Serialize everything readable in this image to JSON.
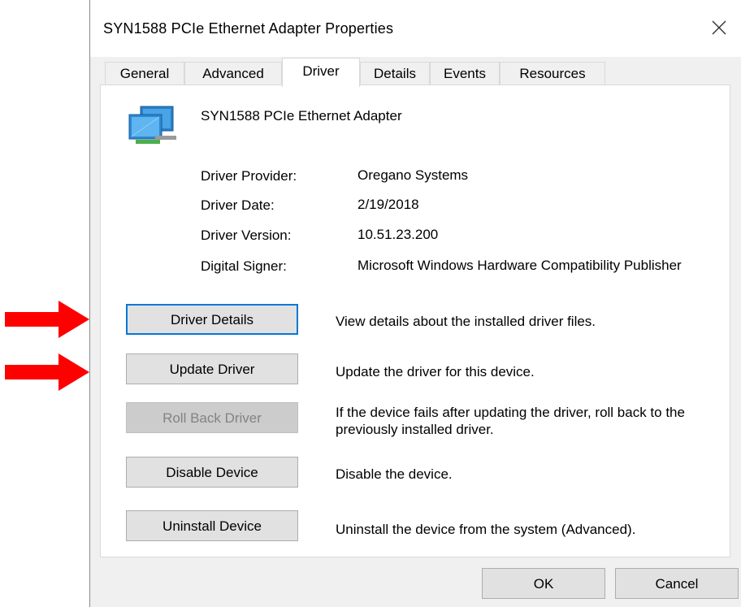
{
  "window": {
    "title": "SYN1588 PCIe Ethernet Adapter Properties",
    "close_icon": "close-icon"
  },
  "tabs": [
    {
      "label": "General",
      "active": false
    },
    {
      "label": "Advanced",
      "active": false
    },
    {
      "label": "Driver",
      "active": true
    },
    {
      "label": "Details",
      "active": false
    },
    {
      "label": "Events",
      "active": false
    },
    {
      "label": "Resources",
      "active": false
    }
  ],
  "device": {
    "icon": "network-adapter-icon",
    "name": "SYN1588 PCIe Ethernet Adapter"
  },
  "driver_info": [
    {
      "label": "Driver Provider:",
      "value": "Oregano Systems"
    },
    {
      "label": "Driver Date:",
      "value": "2/19/2018"
    },
    {
      "label": "Driver Version:",
      "value": "10.51.23.200"
    },
    {
      "label": "Digital Signer:",
      "value": "Microsoft Windows Hardware Compatibility Publisher"
    }
  ],
  "actions": [
    {
      "label": "Driver Details",
      "description": "View details about the installed driver files.",
      "enabled": true,
      "focused": true
    },
    {
      "label": "Update Driver",
      "description": "Update the driver for this device.",
      "enabled": true,
      "focused": false
    },
    {
      "label": "Roll Back Driver",
      "description": "If the device fails after updating the driver, roll back to the previously installed driver.",
      "enabled": false,
      "focused": false
    },
    {
      "label": "Disable Device",
      "description": "Disable the device.",
      "enabled": true,
      "focused": false
    },
    {
      "label": "Uninstall Device",
      "description": "Uninstall the device from the system (Advanced).",
      "enabled": true,
      "focused": false
    }
  ],
  "footer": {
    "ok_label": "OK",
    "cancel_label": "Cancel"
  },
  "annotations": {
    "arrow_color": "#ff0000",
    "arrow_icon": "red-arrow-icon"
  },
  "colors": {
    "focus_border": "#0078d7",
    "button_face": "#e1e1e1",
    "disabled_face": "#cccccc"
  }
}
